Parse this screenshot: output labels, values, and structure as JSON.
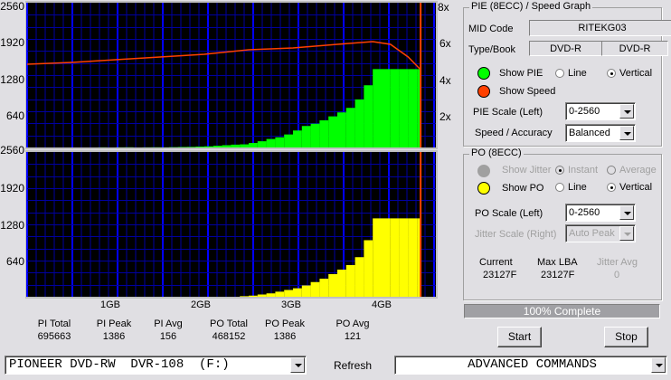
{
  "chart_data": [
    {
      "type": "bar",
      "series": [
        {
          "name": "PIE",
          "color": "#00ff00"
        },
        {
          "name": "Speed",
          "color": "#ff4000"
        }
      ],
      "xlabel": "",
      "xunit": "GB",
      "x_range": [
        0,
        4.6
      ],
      "x_ticks": [
        "1GB",
        "2GB",
        "3GB",
        "4GB"
      ],
      "left_ticks": [
        "2560",
        "1920",
        "1280",
        "640"
      ],
      "ylim_left": [
        0,
        2560
      ],
      "right_ticks": [
        "8x",
        "6x",
        "4x",
        "2x"
      ],
      "ylim_right": [
        0,
        8
      ],
      "grid": true,
      "background": "#000000",
      "x": [
        0,
        0.1,
        0.2,
        0.3,
        0.4,
        0.5,
        0.6,
        0.7,
        0.8,
        0.9,
        1.0,
        1.1,
        1.2,
        1.3,
        1.4,
        1.5,
        1.6,
        1.7,
        1.8,
        1.9,
        2.0,
        2.1,
        2.2,
        2.3,
        2.4,
        2.5,
        2.6,
        2.7,
        2.8,
        2.9,
        3.0,
        3.1,
        3.2,
        3.3,
        3.4,
        3.5,
        3.6,
        3.7,
        3.8,
        3.9,
        4.0,
        4.1,
        4.2,
        4.3,
        4.4
      ],
      "pie": [
        0,
        0,
        0,
        0,
        0,
        0,
        0,
        0,
        2,
        0,
        2,
        3,
        0,
        2,
        3,
        2,
        5,
        8,
        10,
        15,
        20,
        30,
        40,
        50,
        55,
        80,
        110,
        150,
        180,
        230,
        300,
        380,
        420,
        480,
        550,
        620,
        700,
        850,
        1100,
        1386,
        1386,
        1386,
        1386,
        1386,
        1386
      ],
      "speed_x": [
        0,
        0.5,
        1.0,
        1.5,
        2.0,
        2.5,
        3.0,
        3.5,
        3.9,
        4.1,
        4.3,
        4.44
      ],
      "speed": [
        4.6,
        4.7,
        4.85,
        5.0,
        5.15,
        5.4,
        5.5,
        5.7,
        5.85,
        5.7,
        5.0,
        4.3
      ],
      "end_marker_gb": 4.44
    },
    {
      "type": "bar",
      "series": [
        {
          "name": "PO",
          "color": "#ffff00"
        }
      ],
      "xunit": "GB",
      "x_range": [
        0,
        4.6
      ],
      "left_ticks": [
        "2560",
        "1920",
        "1280",
        "640"
      ],
      "ylim_left": [
        0,
        2560
      ],
      "grid": true,
      "po": [
        0,
        0,
        0,
        0,
        0,
        0,
        0,
        0,
        0,
        0,
        0,
        0,
        0,
        0,
        0,
        0,
        0,
        0,
        0,
        0,
        0,
        0,
        0,
        0,
        10,
        20,
        40,
        60,
        90,
        120,
        150,
        200,
        260,
        320,
        400,
        480,
        560,
        700,
        1000,
        1386,
        1386,
        1386,
        1386,
        1386,
        1386
      ],
      "end_marker_gb": 4.44
    }
  ],
  "stats": {
    "labels": [
      "PI Total",
      "PI Peak",
      "PI Avg",
      "PO Total",
      "PO Peak",
      "PO Avg"
    ],
    "values": [
      "695663",
      "1386",
      "156",
      "468152",
      "1386",
      "121"
    ]
  },
  "pie_group": {
    "title": "PIE (8ECC) / Speed Graph",
    "mid_label": "MID Code",
    "mid_value": "RITEKG03",
    "type_label": "Type/Book",
    "type_value": "DVD-R",
    "book_value": "DVD-R",
    "show_pie": "Show PIE",
    "line": "Line",
    "vertical": "Vertical",
    "show_speed": "Show Speed",
    "scale_label": "PIE Scale (Left)",
    "scale_value": "0-2560",
    "speed_label": "Speed / Accuracy",
    "speed_value": "Balanced",
    "pie_color": "#00ff00",
    "speed_color": "#ff4000"
  },
  "po_group": {
    "title": "PO (8ECC)",
    "show_jitter": "Show Jitter",
    "instant": "Instant",
    "average": "Average",
    "show_po": "Show PO",
    "line": "Line",
    "vertical": "Vertical",
    "scale_label": "PO Scale (Left)",
    "scale_value": "0-2560",
    "jitter_label": "Jitter Scale (Right)",
    "jitter_value": "Auto Peak",
    "current_label": "Current",
    "current_value": "23127F",
    "maxlba_label": "Max LBA",
    "maxlba_value": "23127F",
    "jitter_avg_label": "Jitter Avg",
    "jitter_avg_value": "0",
    "po_color": "#ffff00"
  },
  "progress": {
    "text": "100% Complete",
    "percent": 100
  },
  "buttons": {
    "start": "Start",
    "stop": "Stop",
    "refresh": "Refresh"
  },
  "drive": {
    "value": "PIONEER DVD-RW  DVR-108  (F:)"
  },
  "commands": {
    "value": "ADVANCED COMMANDS"
  }
}
